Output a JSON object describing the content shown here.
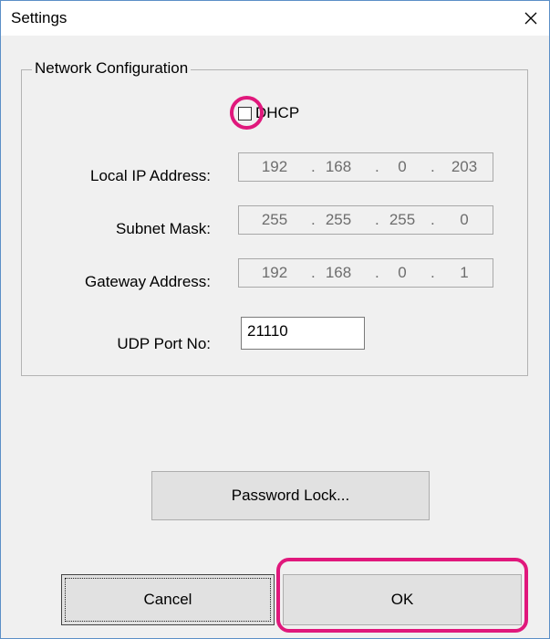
{
  "window": {
    "title": "Settings",
    "close_icon": "close-icon"
  },
  "network": {
    "group_title": "Network Configuration",
    "dhcp": {
      "label": "DHCP",
      "checked": false
    },
    "local_ip": {
      "label": "Local IP Address:",
      "octets": [
        "192",
        "168",
        "0",
        "203"
      ]
    },
    "subnet_mask": {
      "label": "Subnet Mask:",
      "octets": [
        "255",
        "255",
        "255",
        "0"
      ]
    },
    "gateway": {
      "label": "Gateway Address:",
      "octets": [
        "192",
        "168",
        "0",
        "1"
      ]
    },
    "udp_port": {
      "label": "UDP Port No:",
      "value": "21110"
    },
    "octet_separator": "."
  },
  "buttons": {
    "password_lock": "Password Lock...",
    "cancel": "Cancel",
    "ok": "OK"
  },
  "colors": {
    "highlight": "#e0187c",
    "window_border": "#5b8fc7",
    "disabled_text": "#6d6d6d"
  }
}
